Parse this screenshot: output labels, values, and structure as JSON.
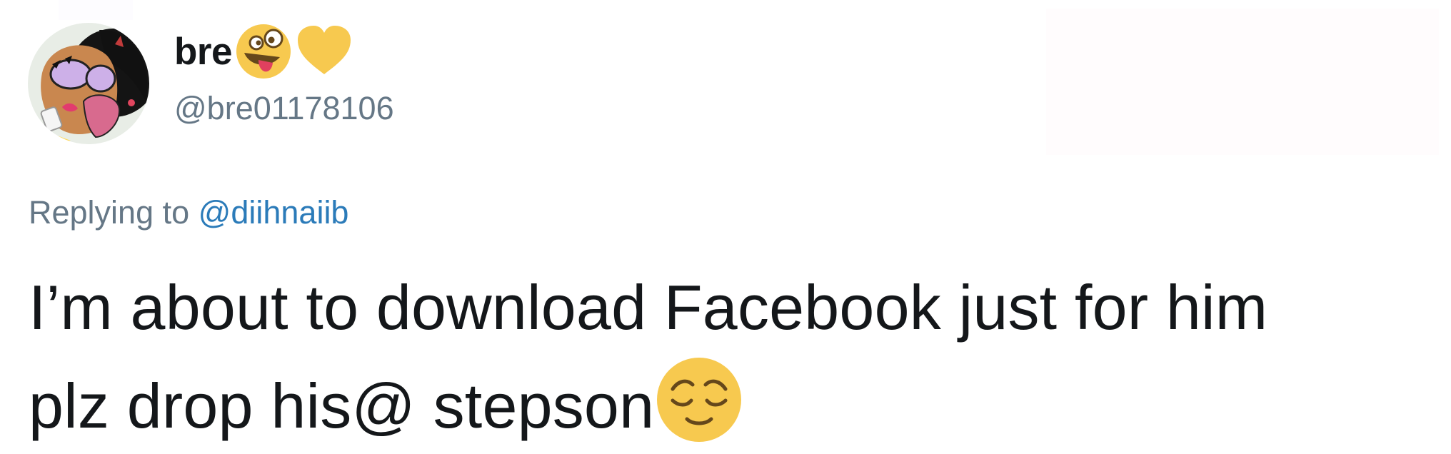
{
  "tweet": {
    "author": {
      "display_name": "bre",
      "handle": "@bre01178106",
      "avatar": "cartoon-girl-avatar",
      "name_emojis": [
        "zany-face-emoji",
        "yellow-heart-emoji"
      ]
    },
    "reply": {
      "prefix": "Replying to",
      "mention": "@diihnaiib"
    },
    "text": {
      "line1": "I’m about to download Facebook just for him",
      "line2": "plz drop his@ stepson",
      "trailing_emoji": "relieved-face-emoji"
    },
    "colors": {
      "text": "#14171a",
      "secondary": "#657786",
      "link": "#2b7bb9",
      "emoji_yellow": "#f7c94f"
    }
  }
}
